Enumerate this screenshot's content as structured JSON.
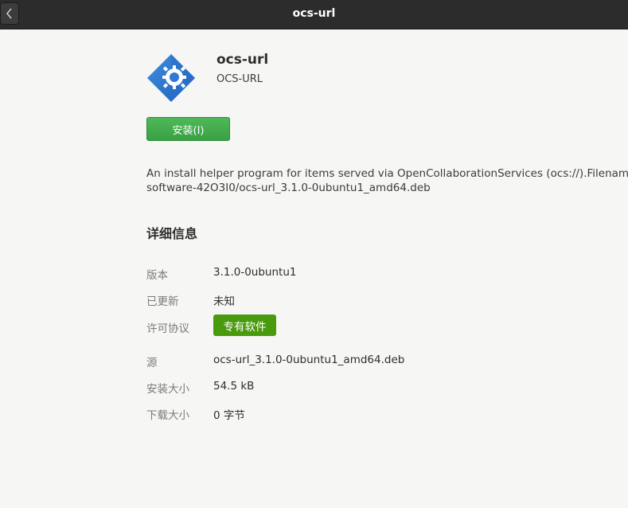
{
  "header": {
    "title": "ocs-url",
    "back_icon": "chevron-left-icon"
  },
  "app": {
    "name": "ocs-url",
    "summary": "OCS-URL",
    "icon": "ocs-url-app-icon",
    "install_label": "安装(I)"
  },
  "description": {
    "line1": "An install helper program for items served via OpenCollaborationServices (ocs://).Filename:",
    "line2": "software-42O3I0/ocs-url_3.1.0-0ubuntu1_amd64.deb"
  },
  "details": {
    "heading": "详细信息",
    "version_label": "版本",
    "version_value": "3.1.0-0ubuntu1",
    "updated_label": "已更新",
    "updated_value": "未知",
    "license_label": "许可协议",
    "license_value": "专有软件",
    "source_label": "源",
    "source_value": "ocs-url_3.1.0-0ubuntu1_amd64.deb",
    "installed_size_label": "安装大小",
    "installed_size_value": "54.5 kB",
    "download_size_label": "下载大小",
    "download_size_value": "0 字节"
  },
  "colors": {
    "header_bg": "#2c2c2c",
    "install_button": "#3aa044",
    "license_badge": "#4a9a0e",
    "page_bg": "#f6f6f5"
  }
}
